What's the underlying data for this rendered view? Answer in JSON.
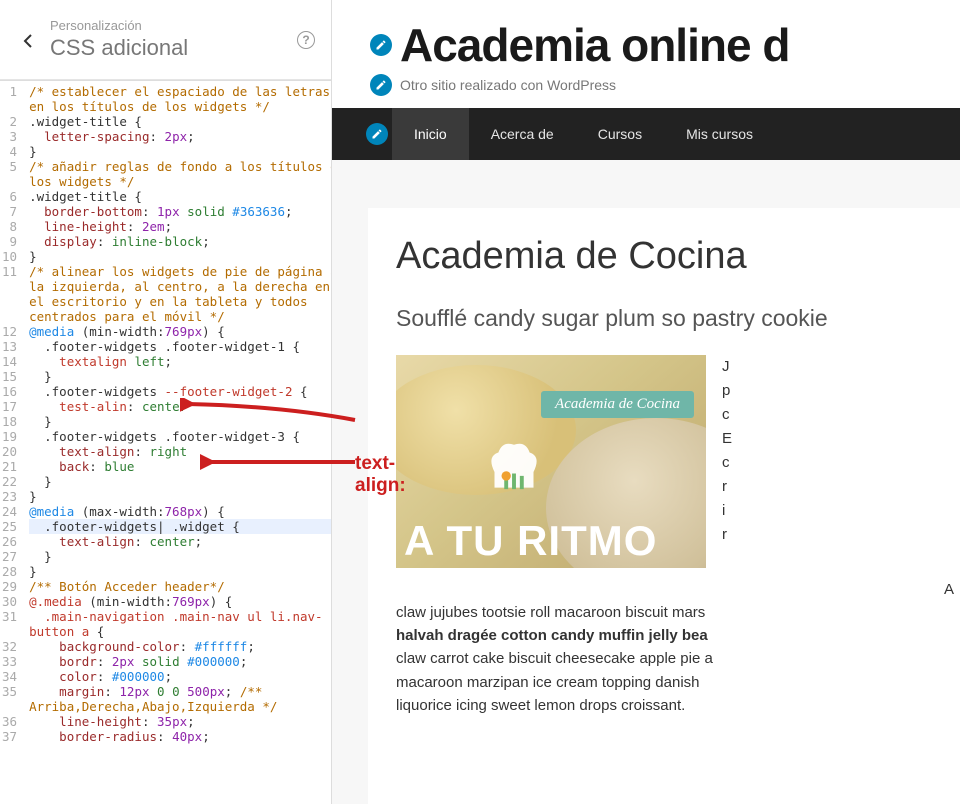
{
  "sidebar": {
    "breadcrumb": "Personalización",
    "title": "CSS adicional",
    "help": "?"
  },
  "code": {
    "lines": [
      {
        "n": 1,
        "seg": [
          {
            "c": "cm",
            "t": "/* establecer el espaciado de las letras "
          }
        ]
      },
      {
        "n": "",
        "seg": [
          {
            "c": "cm",
            "t": "en los títulos de los widgets */"
          }
        ]
      },
      {
        "n": 2,
        "seg": [
          {
            "c": "sel",
            "t": ".widget-title {"
          }
        ]
      },
      {
        "n": 3,
        "seg": [
          {
            "c": "",
            "t": "  "
          },
          {
            "c": "prop",
            "t": "letter-spacing"
          },
          {
            "c": "",
            "t": ": "
          },
          {
            "c": "px",
            "t": "2px"
          },
          {
            "c": "",
            "t": ";"
          }
        ]
      },
      {
        "n": 4,
        "seg": [
          {
            "c": "sel",
            "t": "}"
          }
        ]
      },
      {
        "n": 5,
        "seg": [
          {
            "c": "cm",
            "t": "/* añadir reglas de fondo a los títulos de "
          }
        ]
      },
      {
        "n": "",
        "seg": [
          {
            "c": "cm",
            "t": "los widgets */"
          }
        ]
      },
      {
        "n": 6,
        "seg": [
          {
            "c": "sel",
            "t": ".widget-title {"
          }
        ]
      },
      {
        "n": 7,
        "seg": [
          {
            "c": "",
            "t": "  "
          },
          {
            "c": "prop",
            "t": "border-bottom"
          },
          {
            "c": "",
            "t": ": "
          },
          {
            "c": "px",
            "t": "1px"
          },
          {
            "c": "",
            "t": " "
          },
          {
            "c": "val",
            "t": "solid "
          },
          {
            "c": "hex",
            "t": "#363636"
          },
          {
            "c": "",
            "t": ";"
          }
        ]
      },
      {
        "n": 8,
        "seg": [
          {
            "c": "",
            "t": "  "
          },
          {
            "c": "prop",
            "t": "line-height"
          },
          {
            "c": "",
            "t": ": "
          },
          {
            "c": "px",
            "t": "2em"
          },
          {
            "c": "",
            "t": ";"
          }
        ]
      },
      {
        "n": 9,
        "seg": [
          {
            "c": "",
            "t": "  "
          },
          {
            "c": "prop",
            "t": "display"
          },
          {
            "c": "",
            "t": ": "
          },
          {
            "c": "val",
            "t": "inline-block"
          },
          {
            "c": "",
            "t": ";"
          }
        ]
      },
      {
        "n": 10,
        "seg": [
          {
            "c": "sel",
            "t": "}"
          }
        ]
      },
      {
        "n": 11,
        "seg": [
          {
            "c": "cm",
            "t": "/* alinear los widgets de pie de página a "
          }
        ]
      },
      {
        "n": "",
        "seg": [
          {
            "c": "cm",
            "t": "la izquierda, al centro, a la derecha en "
          }
        ]
      },
      {
        "n": "",
        "seg": [
          {
            "c": "cm",
            "t": "el escritorio y en la tableta y todos "
          }
        ]
      },
      {
        "n": "",
        "seg": [
          {
            "c": "cm",
            "t": "centrados para el móvil */"
          }
        ]
      },
      {
        "n": 12,
        "seg": [
          {
            "c": "kw",
            "t": "@media"
          },
          {
            "c": "sel",
            "t": " (min-width:"
          },
          {
            "c": "px",
            "t": "769px"
          },
          {
            "c": "sel",
            "t": ") {"
          }
        ]
      },
      {
        "n": 13,
        "seg": [
          {
            "c": "sel",
            "t": "  .footer-widgets .footer-widget-1 {"
          }
        ]
      },
      {
        "n": 14,
        "seg": [
          {
            "c": "",
            "t": "    "
          },
          {
            "c": "prop2",
            "t": "textalign"
          },
          {
            "c": "",
            "t": " "
          },
          {
            "c": "val",
            "t": "left"
          },
          {
            "c": "",
            "t": ";"
          }
        ]
      },
      {
        "n": 15,
        "seg": [
          {
            "c": "sel",
            "t": "  }"
          }
        ]
      },
      {
        "n": 16,
        "seg": [
          {
            "c": "sel",
            "t": "  .footer-widgets "
          },
          {
            "c": "prop2",
            "t": "--footer-widget-2"
          },
          {
            "c": "sel",
            "t": " {"
          }
        ]
      },
      {
        "n": 17,
        "seg": [
          {
            "c": "",
            "t": "    "
          },
          {
            "c": "prop2",
            "t": "test-alin"
          },
          {
            "c": "",
            "t": ": "
          },
          {
            "c": "val",
            "t": "center"
          }
        ]
      },
      {
        "n": 18,
        "seg": [
          {
            "c": "sel",
            "t": "  }"
          }
        ]
      },
      {
        "n": 19,
        "seg": [
          {
            "c": "sel",
            "t": "  .footer-widgets .footer-widget-3 {"
          }
        ]
      },
      {
        "n": 20,
        "seg": [
          {
            "c": "",
            "t": "    "
          },
          {
            "c": "prop",
            "t": "text-align"
          },
          {
            "c": "",
            "t": ": "
          },
          {
            "c": "val",
            "t": "right"
          }
        ]
      },
      {
        "n": 21,
        "seg": [
          {
            "c": "",
            "t": "    "
          },
          {
            "c": "prop",
            "t": "back"
          },
          {
            "c": "",
            "t": ": "
          },
          {
            "c": "val",
            "t": "blue"
          }
        ]
      },
      {
        "n": 22,
        "seg": [
          {
            "c": "sel",
            "t": "  }"
          }
        ]
      },
      {
        "n": 23,
        "seg": [
          {
            "c": "sel",
            "t": "}"
          }
        ]
      },
      {
        "n": 24,
        "seg": [
          {
            "c": "kw",
            "t": "@media"
          },
          {
            "c": "sel",
            "t": " (max-width:"
          },
          {
            "c": "px",
            "t": "768px"
          },
          {
            "c": "sel",
            "t": ") {"
          }
        ]
      },
      {
        "n": 25,
        "hl": true,
        "seg": [
          {
            "c": "sel",
            "t": "  .footer-widgets| .widget {"
          }
        ]
      },
      {
        "n": 26,
        "seg": [
          {
            "c": "",
            "t": "    "
          },
          {
            "c": "prop",
            "t": "text-align"
          },
          {
            "c": "",
            "t": ": "
          },
          {
            "c": "val",
            "t": "center"
          },
          {
            "c": "",
            "t": ";"
          }
        ]
      },
      {
        "n": 27,
        "seg": [
          {
            "c": "sel",
            "t": "  }"
          }
        ]
      },
      {
        "n": 28,
        "seg": [
          {
            "c": "sel",
            "t": "}"
          }
        ]
      },
      {
        "n": 29,
        "seg": [
          {
            "c": "cm",
            "t": "/** Botón Acceder header*/"
          }
        ]
      },
      {
        "n": 30,
        "seg": [
          {
            "c": "prop2",
            "t": "@.media"
          },
          {
            "c": "sel",
            "t": " (min-width:"
          },
          {
            "c": "px",
            "t": "769px"
          },
          {
            "c": "sel",
            "t": ") {"
          }
        ]
      },
      {
        "n": 31,
        "seg": [
          {
            "c": "prop2",
            "t": "  .main-navigation .main-nav ul li.nav-"
          }
        ]
      },
      {
        "n": "",
        "seg": [
          {
            "c": "prop2",
            "t": "button a"
          },
          {
            "c": "sel",
            "t": " {"
          }
        ]
      },
      {
        "n": 32,
        "seg": [
          {
            "c": "",
            "t": "    "
          },
          {
            "c": "prop",
            "t": "background-color"
          },
          {
            "c": "",
            "t": ": "
          },
          {
            "c": "hex",
            "t": "#ffffff"
          },
          {
            "c": "",
            "t": ";"
          }
        ]
      },
      {
        "n": 33,
        "seg": [
          {
            "c": "",
            "t": "    "
          },
          {
            "c": "prop",
            "t": "bordr"
          },
          {
            "c": "",
            "t": ": "
          },
          {
            "c": "px",
            "t": "2px"
          },
          {
            "c": "",
            "t": " "
          },
          {
            "c": "val",
            "t": "solid "
          },
          {
            "c": "hex",
            "t": "#000000"
          },
          {
            "c": "",
            "t": ";"
          }
        ]
      },
      {
        "n": 34,
        "seg": [
          {
            "c": "",
            "t": "    "
          },
          {
            "c": "prop",
            "t": "color"
          },
          {
            "c": "",
            "t": ": "
          },
          {
            "c": "hex",
            "t": "#000000"
          },
          {
            "c": "",
            "t": ";"
          }
        ]
      },
      {
        "n": 35,
        "seg": [
          {
            "c": "",
            "t": "    "
          },
          {
            "c": "prop",
            "t": "margin"
          },
          {
            "c": "",
            "t": ": "
          },
          {
            "c": "px",
            "t": "12px"
          },
          {
            "c": "",
            "t": " "
          },
          {
            "c": "num",
            "t": "0"
          },
          {
            "c": "",
            "t": " "
          },
          {
            "c": "num",
            "t": "0"
          },
          {
            "c": "",
            "t": " "
          },
          {
            "c": "px",
            "t": "500px"
          },
          {
            "c": "",
            "t": "; "
          },
          {
            "c": "cm",
            "t": "/** "
          }
        ]
      },
      {
        "n": "",
        "seg": [
          {
            "c": "cm",
            "t": "Arriba,Derecha,Abajo,Izquierda */"
          }
        ]
      },
      {
        "n": 36,
        "seg": [
          {
            "c": "",
            "t": "    "
          },
          {
            "c": "prop",
            "t": "line-height"
          },
          {
            "c": "",
            "t": ": "
          },
          {
            "c": "px",
            "t": "35px"
          },
          {
            "c": "",
            "t": ";"
          }
        ]
      },
      {
        "n": 37,
        "seg": [
          {
            "c": "",
            "t": "    "
          },
          {
            "c": "prop",
            "t": "border-radius"
          },
          {
            "c": "",
            "t": ": "
          },
          {
            "c": "px",
            "t": "40px"
          },
          {
            "c": "",
            "t": ";"
          }
        ]
      }
    ]
  },
  "site": {
    "title": "Academia online d",
    "tagline": "Otro sitio realizado con WordPress"
  },
  "nav": {
    "items": [
      {
        "label": "Inicio",
        "active": true
      },
      {
        "label": "Acerca de",
        "active": false
      },
      {
        "label": "Cursos",
        "active": false
      },
      {
        "label": "Mis cursos",
        "active": false
      }
    ]
  },
  "content": {
    "title": "Academia de Cocina",
    "sub": "Soufflé candy sugar plum so pastry cookie",
    "img_badge": "Academia de Cocina",
    "img_ritmo": "A TU RITMO",
    "side_letters": [
      "J",
      "p",
      "c",
      "E",
      "c",
      "r",
      "i",
      "r"
    ],
    "para_pre": "A",
    "para_line1": "claw jujubes tootsie roll macaroon biscuit mars",
    "para_bold": "halvah dragée cotton candy muffin jelly bea",
    "para_line2": "claw carrot cake biscuit cheesecake apple pie a",
    "para_line3": "macaroon marzipan ice cream topping danish ",
    "para_line4": "liquorice icing sweet lemon drops croissant."
  },
  "annotation": {
    "label": "text-align:"
  }
}
